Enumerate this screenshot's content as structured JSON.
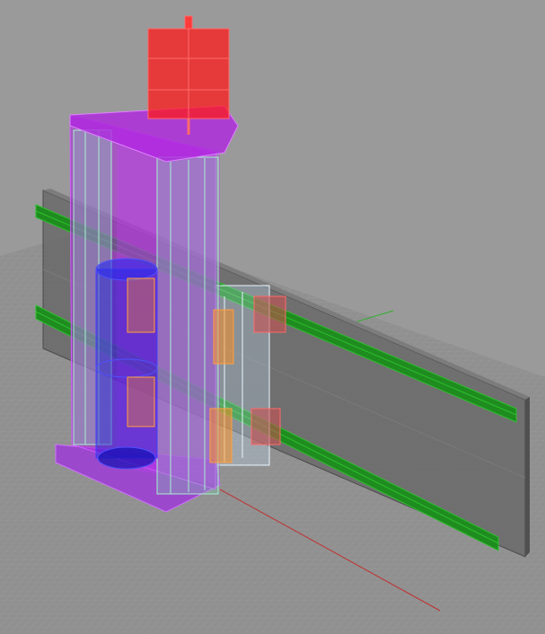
{
  "viewport": {
    "background": "#9a9a9a",
    "floor_color": "#8e8e8e",
    "grid_color": "#a2a2a2",
    "axis_x_color": "#c03030",
    "axis_y_color": "#30a030"
  },
  "parts": {
    "motor": {
      "color": "#ff1a1a",
      "icon": "motor-block"
    },
    "column": {
      "color": "#b025e0",
      "edge": "#d060ff"
    },
    "column_rails": {
      "color": "#7fd0b0"
    },
    "leadscrew_cylinder": {
      "color": "#1a1adc"
    },
    "bearing_blocks": {
      "color": "#ff8c1a"
    },
    "rail_carriage": {
      "color": "#c0e0ff"
    },
    "gantry_plate": {
      "color": "#6a6a6a"
    },
    "linear_rails": {
      "color": "#1e8c1e"
    }
  }
}
